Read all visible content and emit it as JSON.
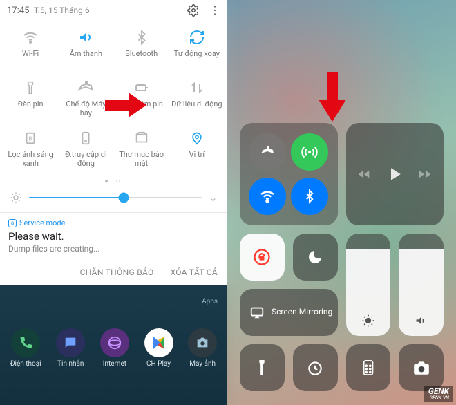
{
  "android": {
    "status": {
      "time": "17:45",
      "date": "T.5, 15 Tháng 6"
    },
    "tiles": [
      {
        "name": "wifi",
        "label": "Wi-Fi",
        "active": false
      },
      {
        "name": "sound",
        "label": "Âm thanh",
        "active": true
      },
      {
        "name": "bluetooth",
        "label": "Bluetooth",
        "active": false
      },
      {
        "name": "rotate",
        "label": "Tự động xoay",
        "active": true
      },
      {
        "name": "flashlight",
        "label": "Đèn pin",
        "active": false
      },
      {
        "name": "airplane",
        "label": "Chế độ Máy bay",
        "active": false
      },
      {
        "name": "battery",
        "label": "Tiết kiệm pin",
        "active": false
      },
      {
        "name": "mobiledata",
        "label": "Dữ liệu di động",
        "active": false
      },
      {
        "name": "bluelight",
        "label": "Lọc ánh sáng xanh",
        "active": false
      },
      {
        "name": "hotspot",
        "label": "Đ.truy cập di động",
        "active": false
      },
      {
        "name": "secure",
        "label": "Thư mục bảo mật",
        "active": false
      },
      {
        "name": "location",
        "label": "Vị trí",
        "active": true
      }
    ],
    "brightness_percent": 55,
    "notification": {
      "app_label": "Service mode",
      "title": "Please wait.",
      "body": "Dump files are creating..."
    },
    "actions": {
      "block": "CHẶN THÔNG BÁO",
      "clear": "XÓA TẤT CẢ"
    },
    "homescreen_apps_label": "Apps",
    "dock": [
      {
        "name": "phone",
        "label": "Điện thoại",
        "bg": "#14403a"
      },
      {
        "name": "message",
        "label": "Tin nhắn",
        "bg": "#2a2f5e"
      },
      {
        "name": "browser",
        "label": "Internet",
        "bg": "#5a2f7e"
      },
      {
        "name": "store",
        "label": "CH Play",
        "bg": "#ffffff"
      },
      {
        "name": "camera",
        "label": "Máy ảnh",
        "bg": "#2e3a42"
      }
    ]
  },
  "ios": {
    "connectivity": [
      {
        "name": "airplane",
        "color": "gray"
      },
      {
        "name": "cellular",
        "color": "green"
      },
      {
        "name": "wifi",
        "color": "blue"
      },
      {
        "name": "bluetooth",
        "color": "blue"
      }
    ],
    "screen_mirroring_label": "Screen Mirroring",
    "brightness_percent": 85,
    "volume_percent": 85
  },
  "watermark": {
    "brand": "GENK",
    "site": "GENK.VN"
  }
}
